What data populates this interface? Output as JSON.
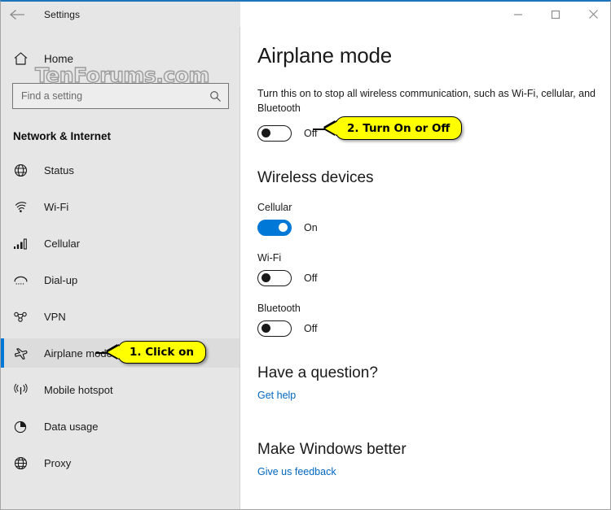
{
  "window": {
    "title": "Settings",
    "back_icon": "back-arrow-icon",
    "controls": {
      "minimize": "minimize-icon",
      "maximize": "maximize-icon",
      "close": "close-icon"
    }
  },
  "sidebar": {
    "home_label": "Home",
    "home_icon": "home-icon",
    "search": {
      "value": "",
      "placeholder": "Find a setting",
      "icon": "search-icon"
    },
    "watermark": "TenForums.com",
    "category_title": "Network & Internet",
    "items": [
      {
        "label": "Status",
        "icon": "globe-status-icon",
        "selected": false
      },
      {
        "label": "Wi-Fi",
        "icon": "wifi-icon",
        "selected": false
      },
      {
        "label": "Cellular",
        "icon": "signal-bars-icon",
        "selected": false
      },
      {
        "label": "Dial-up",
        "icon": "phone-handset-icon",
        "selected": false
      },
      {
        "label": "VPN",
        "icon": "vpn-nodes-icon",
        "selected": false
      },
      {
        "label": "Airplane mode",
        "icon": "airplane-icon",
        "selected": true
      },
      {
        "label": "Mobile hotspot",
        "icon": "broadcast-icon",
        "selected": false
      },
      {
        "label": "Data usage",
        "icon": "pie-chart-icon",
        "selected": false
      },
      {
        "label": "Proxy",
        "icon": "globe-icon",
        "selected": false
      }
    ]
  },
  "main": {
    "page_title": "Airplane mode",
    "description": "Turn this on to stop all wireless communication, such as Wi-Fi, cellular, and Bluetooth",
    "airplane_toggle": {
      "state": "off",
      "label": "Off"
    },
    "wireless_section_title": "Wireless devices",
    "devices": [
      {
        "name": "Cellular",
        "state": "on",
        "label": "On"
      },
      {
        "name": "Wi-Fi",
        "state": "off",
        "label": "Off"
      },
      {
        "name": "Bluetooth",
        "state": "off",
        "label": "Off"
      }
    ],
    "help": {
      "title": "Have a question?",
      "link": "Get help"
    },
    "feedback": {
      "title": "Make Windows better",
      "link": "Give us feedback"
    }
  },
  "callouts": [
    {
      "text": "1. Click on"
    },
    {
      "text": "2. Turn On or Off"
    }
  ],
  "colors": {
    "accent": "#0078d7",
    "sidebar_bg": "#e6e6e6",
    "callout_bg": "#ffff00",
    "link": "#0067c0",
    "titlebar_border": "#1b73ba"
  }
}
